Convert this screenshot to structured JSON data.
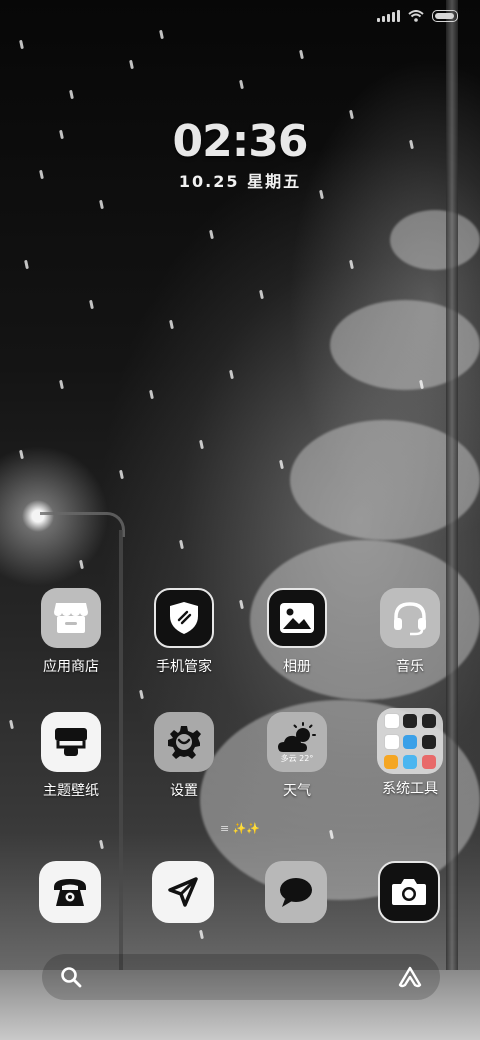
{
  "clock": {
    "time": "02:36",
    "date": "10.25  星期五"
  },
  "apps": {
    "row1": [
      "应用商店",
      "手机管家",
      "相册",
      "音乐"
    ],
    "row2": [
      "主题壁纸",
      "设置",
      "天气",
      "系统工具"
    ]
  },
  "weather_widget": {
    "condition": "多云",
    "temp": "22°"
  },
  "page_indicator": "≡ ✨✨",
  "dock": [
    "phone-icon",
    "navigation-icon",
    "message-icon",
    "camera-icon"
  ],
  "icons": {
    "app_store": "store-icon",
    "security": "shield-icon",
    "gallery": "image-icon",
    "music": "headphones-icon",
    "themes": "paint-roller-icon",
    "settings": "gear-icon",
    "weather": "cloud-sun-icon",
    "tools": "folder-icon"
  },
  "colors": {
    "icon_grey": "#bdbdbd",
    "icon_black": "#111111",
    "icon_white": "#f4f4f4"
  }
}
